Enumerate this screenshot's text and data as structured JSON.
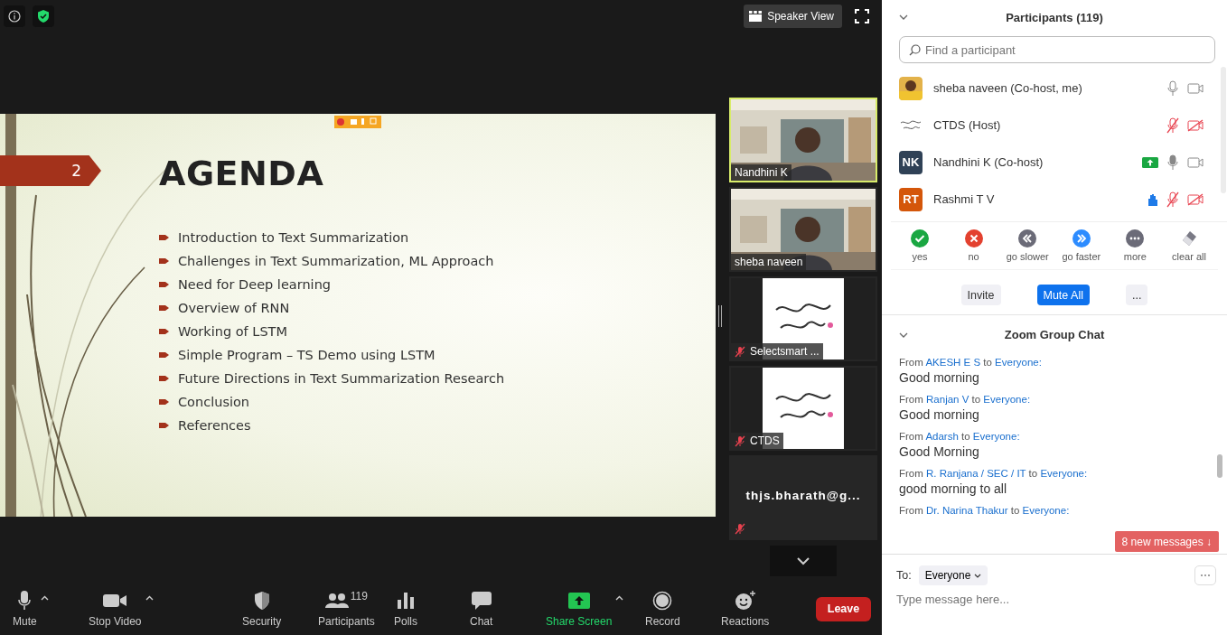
{
  "top_bar": {
    "view_button": "Speaker View"
  },
  "slide": {
    "number": "2",
    "title": "AGENDA",
    "bullets": [
      "Introduction to Text Summarization",
      "Challenges in Text Summarization, ML Approach",
      "Need for Deep learning",
      "Overview of RNN",
      "Working of LSTM",
      "Simple Program – TS Demo using LSTM",
      "Future Directions in Text Summarization Research",
      "Conclusion",
      "References"
    ]
  },
  "videos": [
    {
      "name": "Nandhini K",
      "kind": "camera",
      "active": true,
      "muted": false
    },
    {
      "name": "sheba naveen",
      "kind": "camera",
      "active": false,
      "muted": false
    },
    {
      "name": "Selectsmart ...",
      "active": false,
      "muted": true
    },
    {
      "name": "CTDS",
      "active": false,
      "muted": true
    },
    {
      "name": "thjs.bharath@g...",
      "kind": "name",
      "active": false,
      "muted": true
    }
  ],
  "toolbar": [
    {
      "label": "Mute",
      "kind": "mic",
      "caret": true
    },
    {
      "label": "Stop Video",
      "kind": "video",
      "caret": true
    },
    {
      "label": "Security",
      "kind": "shield",
      "caret": false
    },
    {
      "label": "Participants",
      "kind": "people",
      "caret": false,
      "badge": "119"
    },
    {
      "label": "Polls",
      "kind": "polls",
      "caret": false
    },
    {
      "label": "Chat",
      "kind": "chat",
      "caret": false
    },
    {
      "label": "Share Screen",
      "kind": "share",
      "caret": true
    },
    {
      "label": "Record",
      "kind": "record",
      "caret": false
    },
    {
      "label": "Reactions",
      "kind": "reactions",
      "caret": false
    }
  ],
  "leave_button": "Leave",
  "participants": {
    "title": "Participants (119)",
    "search_placeholder": "Find a participant",
    "people": [
      {
        "name": "sheba naveen (Co-host, me)",
        "mic_muted": false,
        "video_off": false,
        "sharing": false,
        "hand_raised": false
      },
      {
        "name": "CTDS (Host)",
        "mic_muted": true,
        "video_off": true,
        "sharing": false,
        "hand_raised": false
      },
      {
        "name": "Nandhini K (Co-host)",
        "kind": "initials",
        "initials": "NK",
        "color": "#2f4156",
        "mic_muted": false,
        "video_off": false,
        "sharing": true,
        "hand_raised": false
      },
      {
        "name": "Rashmi T V",
        "kind": "initials",
        "initials": "RT",
        "color": "#d4560a",
        "mic_muted": true,
        "video_off": true,
        "sharing": false,
        "hand_raised": true
      }
    ],
    "reactions": [
      {
        "label": "yes",
        "kind": "yes"
      },
      {
        "label": "no",
        "kind": "no"
      },
      {
        "label": "go slower",
        "kind": "slower"
      },
      {
        "label": "go faster",
        "kind": "faster"
      },
      {
        "label": "more",
        "kind": "more"
      },
      {
        "label": "clear all",
        "kind": "clear"
      }
    ],
    "buttons": [
      {
        "label": "Invite",
        "primary": false
      },
      {
        "label": "Mute All",
        "primary": true
      },
      {
        "label": "...",
        "primary": false
      }
    ]
  },
  "chat": {
    "title": "Zoom Group Chat",
    "messages": [
      {
        "from": "From",
        "sender": "AKESH E S",
        "to": "to",
        "recipient": "Everyone:",
        "text": "Good morning"
      },
      {
        "from": "From",
        "sender": "Ranjan V",
        "to": "to",
        "recipient": "Everyone:",
        "text": "Good morning"
      },
      {
        "from": "From",
        "sender": "Adarsh",
        "to": "to",
        "recipient": "Everyone:",
        "text": "Good Morning"
      },
      {
        "from": "From",
        "sender": "R. Ranjana / SEC / IT",
        "to": "to",
        "recipient": "Everyone:",
        "text": "good morning to all"
      },
      {
        "from": "From",
        "sender": "Dr. Narina Thakur",
        "to": "to",
        "recipient": "Everyone:"
      }
    ],
    "new_messages": "8 new messages ↓",
    "to_label": "To:",
    "recipient": "Everyone",
    "placeholder": "Type message here..."
  }
}
